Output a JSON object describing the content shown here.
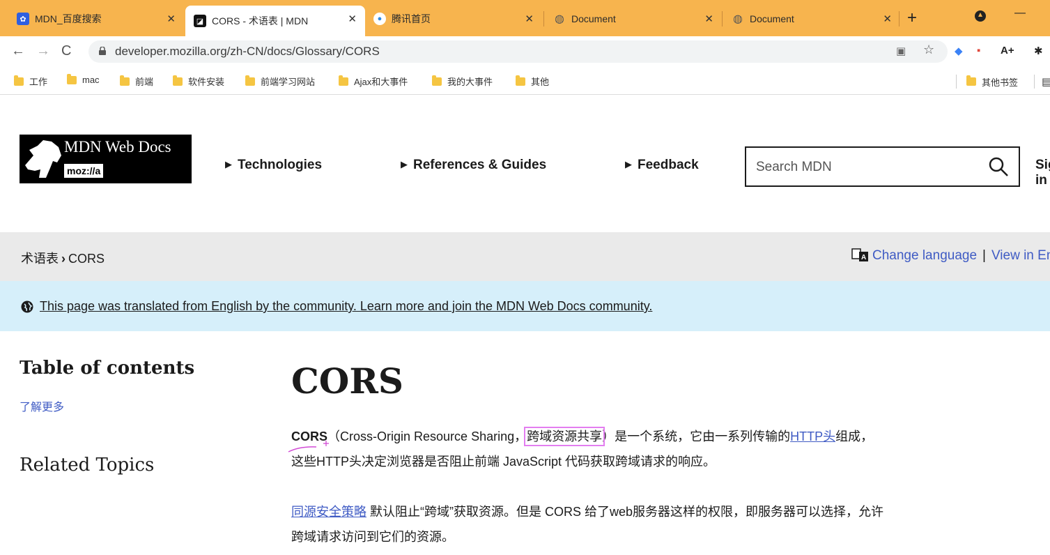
{
  "browser": {
    "tabs": [
      {
        "title": "MDN_百度搜索",
        "favicon": "baidu-icon",
        "active": false
      },
      {
        "title": "CORS - 术语表 | MDN",
        "favicon": "mdn-icon",
        "active": true
      },
      {
        "title": "腾讯首页",
        "favicon": "tencent-icon",
        "active": false
      },
      {
        "title": "Document",
        "favicon": "globe-icon",
        "active": false
      },
      {
        "title": "Document",
        "favicon": "globe-icon",
        "active": false
      }
    ],
    "url": "developer.mozilla.org/zh-CN/docs/Glossary/CORS",
    "bookmarks": [
      "工作",
      "mac",
      "前端",
      "软件安装",
      "前端学习网站",
      "Ajax和大事件",
      "我的大事件",
      "其他"
    ],
    "other_bookmarks": "其他书签",
    "accent": "#f7b44e"
  },
  "header": {
    "logo_text": "MDN Web Docs",
    "logo_sub": "moz://a",
    "nav": [
      "Technologies",
      "References & Guides",
      "Feedback"
    ],
    "search_placeholder": "Search MDN",
    "signin": "Sign in"
  },
  "breadcrumb": {
    "parent": "术语表",
    "current": "CORS",
    "change_language": "Change language",
    "separator": "|",
    "view_in_english": "View in English"
  },
  "notice": {
    "text": "This page was translated from English by the community. Learn more and join the MDN Web Docs community."
  },
  "sidebar": {
    "toc_title": "Table of contents",
    "toc_items": [
      "了解更多"
    ],
    "related_title": "Related Topics"
  },
  "article": {
    "title": "CORS",
    "p1": {
      "term": "CORS",
      "text_a": "（Cross-Origin Resource Sharing，",
      "highlight": "跨域资源共享",
      "text_b": "）是一个系统，它由一系列传输的",
      "link": "HTTP头",
      "text_c": "组成，",
      "line2": "这些HTTP头决定浏览器是否阻止前端 JavaScript 代码获取跨域请求的响应。"
    },
    "p2": {
      "link": "同源安全策略",
      "text_a": " 默认阻止“跨域”获取资源。但是 CORS 给了web服务器这样的权限，即服务器可以选择，允许",
      "line2": "跨域请求访问到它们的资源。"
    }
  }
}
